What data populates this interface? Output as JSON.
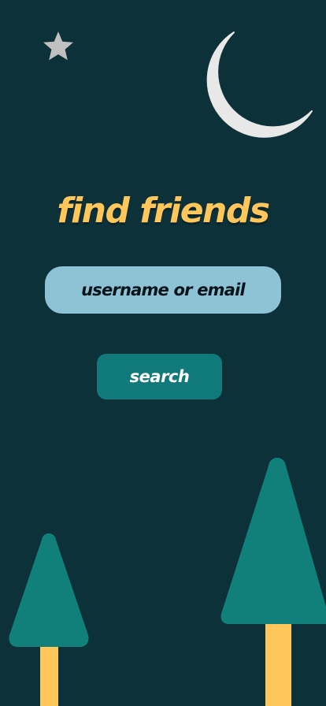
{
  "page": {
    "title": "find friends"
  },
  "search": {
    "placeholder": "username or email",
    "button_label": "search"
  },
  "decorations": {
    "icons": [
      "star-icon",
      "moon-icon",
      "tree-icon"
    ]
  },
  "colors": {
    "background": "#0c3138",
    "title": "#ffc65c",
    "input_bg": "#8dc3d5",
    "button_bg": "#10797a",
    "tree_top": "#11807b",
    "tree_trunk": "#ffc65c",
    "moon": "#e8e8e8",
    "star": "#c0c0c0"
  }
}
